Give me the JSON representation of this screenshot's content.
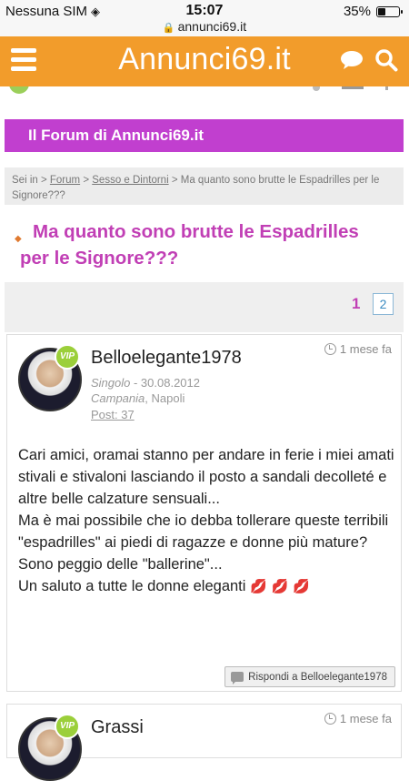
{
  "status_bar": {
    "carrier": "Nessuna SIM",
    "time": "15:07",
    "url": "annunci69.it",
    "battery": "35%",
    "battery_level": 0.35
  },
  "header": {
    "logo": "Annunci69.it",
    "menu_icon": "hamburger-menu-icon",
    "chat_icon": "chat-bubble-icon",
    "search_icon": "search-icon",
    "color": "#f29c2b"
  },
  "forum_title": "Il Forum di Annunci69.it",
  "breadcrumb": {
    "prefix": "Sei in >",
    "forum": "Forum",
    "sep1": ">",
    "section": "Sesso e Dintorni",
    "sep2": ">",
    "current": "Ma quanto sono brutte le Espadrilles per le Signore???"
  },
  "thread_title": "Ma quanto sono brutte le Espadrilles per le Signore???",
  "pagination": {
    "current": "1",
    "next": "2"
  },
  "posts": [
    {
      "badge": "VIP",
      "username": "Belloelegante1978",
      "time": "1 mese fa",
      "status": "Singolo",
      "date": " - 30.08.2012",
      "region": "Campania",
      "city": ", Napoli",
      "posts_label": "Post",
      "posts_count": ": 37",
      "body": [
        "Cari amici, oramai stanno per andare in ferie i miei amati stivali e stivaloni lasciando il posto a sandali decolleté e altre belle calzature sensuali...",
        "Ma è mai possibile che io debba tollerare queste terribili \"espadrilles\" ai piedi di ragazze e donne più mature?",
        "Sono peggio delle \"ballerine\"...",
        "Un saluto a tutte le donne eleganti"
      ],
      "emoji": "💋💋💋",
      "reply_label": "Rispondi a Belloelegante1978"
    },
    {
      "badge": "VIP",
      "username": "Grassi",
      "time": "1 mese fa"
    }
  ],
  "colors": {
    "accent": "#c13fcf",
    "title": "#c13fb5",
    "link": "#3a8ac0"
  }
}
